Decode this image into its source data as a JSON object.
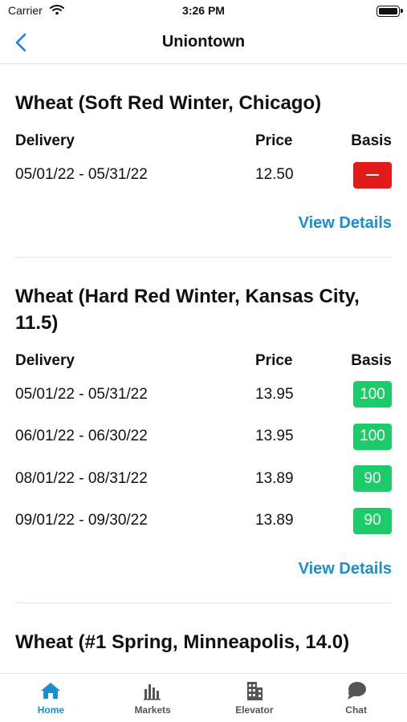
{
  "status_bar": {
    "carrier": "Carrier",
    "time": "3:26 PM"
  },
  "nav": {
    "title": "Uniontown"
  },
  "columns": {
    "delivery": "Delivery",
    "price": "Price",
    "basis": "Basis"
  },
  "sections": [
    {
      "title": "Wheat (Soft Red Winter, Chicago)",
      "rows": [
        {
          "delivery": "05/01/22 - 05/31/22",
          "price": "12.50",
          "basis": "",
          "basis_color": "#e11a1a"
        }
      ],
      "link": "View Details"
    },
    {
      "title": "Wheat (Hard Red Winter, Kansas City, 11.5)",
      "rows": [
        {
          "delivery": "05/01/22 - 05/31/22",
          "price": "13.95",
          "basis": "100",
          "basis_color": "#1ecb6a"
        },
        {
          "delivery": "06/01/22 - 06/30/22",
          "price": "13.95",
          "basis": "100",
          "basis_color": "#1ecb6a"
        },
        {
          "delivery": "08/01/22 - 08/31/22",
          "price": "13.89",
          "basis": "90",
          "basis_color": "#1ecb6a"
        },
        {
          "delivery": "09/01/22 - 09/30/22",
          "price": "13.89",
          "basis": "90",
          "basis_color": "#1ecb6a"
        }
      ],
      "link": "View Details"
    },
    {
      "title": "Wheat (#1 Spring, Minneapolis, 14.0)"
    }
  ],
  "tabs": [
    {
      "label": "Home",
      "icon": "home-icon",
      "active": true
    },
    {
      "label": "Markets",
      "icon": "markets-icon",
      "active": false
    },
    {
      "label": "Elevator",
      "icon": "elevator-icon",
      "active": false
    },
    {
      "label": "Chat",
      "icon": "chat-icon",
      "active": false
    }
  ],
  "colors": {
    "accent": "#1a8fd0",
    "basis_negative": "#e11a1a",
    "basis_positive": "#1ecb6a"
  }
}
